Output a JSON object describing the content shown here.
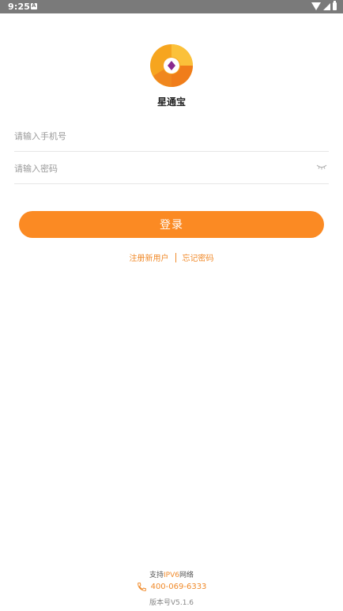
{
  "status_bar": {
    "time": "9:25"
  },
  "app": {
    "name": "星通宝"
  },
  "login_form": {
    "phone_placeholder": "请输入手机号",
    "password_placeholder": "请输入密码",
    "login_label": "登录"
  },
  "links": {
    "register": "注册新用户",
    "forgot": "忘记密码"
  },
  "footer": {
    "ipv6_prefix": "支持",
    "ipv6_accent": "IPV6",
    "ipv6_suffix": "网络",
    "phone": "400-069-6333",
    "version": "版本号V5.1.6"
  },
  "colors": {
    "accent": "#fb8a23",
    "status_bar": "#7a7a7a"
  },
  "icons": [
    "wifi-icon",
    "signal-icon",
    "battery-icon",
    "eye-closed-icon",
    "phone-icon"
  ]
}
